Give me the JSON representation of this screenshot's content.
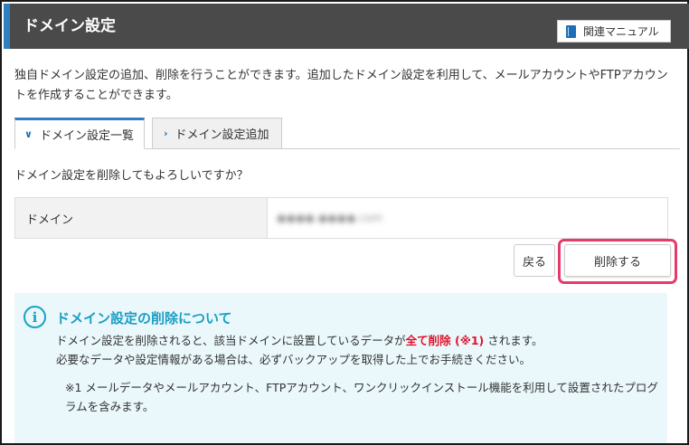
{
  "header": {
    "title": "ドメイン設定",
    "manual_label": "関連マニュアル",
    "accent_color": "#2f7fc1"
  },
  "description": "独自ドメイン設定の追加、削除を行うことができます。追加したドメイン設定を利用して、メールアカウントやFTPアカウントを作成することができます。",
  "tabs": [
    {
      "label": "ドメイン設定一覧",
      "active": true
    },
    {
      "label": "ドメイン設定追加",
      "active": false
    }
  ],
  "confirm_text": "ドメイン設定を削除してもよろしいですか？",
  "domain_row": {
    "label": "ドメイン",
    "value": "●●●●.●●●●.com"
  },
  "buttons": {
    "back": "戻る",
    "delete": "削除する"
  },
  "info": {
    "icon": "info-circle-icon",
    "title": "ドメイン設定の削除について",
    "line1_before": "ドメイン設定を削除されると、該当ドメインに設置しているデータが",
    "line1_emphasis": "全て削除 (※1)",
    "line1_after": " されます。",
    "line2": "必要なデータや設定情報がある場合は、必ずバックアップを取得した上でお手続きください。",
    "note": "※1 メールデータやメールアカウント、FTPアカウント、ワンクリックインストール機能を利用して設置されたプログラムを含みます。",
    "emphasis_color": "#e0132c",
    "title_color": "#1b9ec4"
  },
  "highlight_color": "#e8396b"
}
